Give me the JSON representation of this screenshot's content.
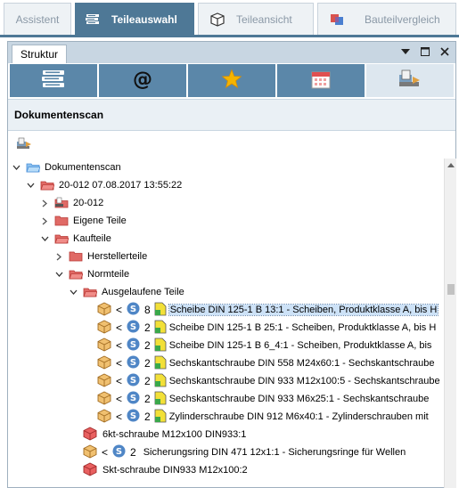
{
  "top_tabs": [
    {
      "label": "Assistent",
      "icon": "none",
      "active": false
    },
    {
      "label": "Teileauswahl",
      "icon": "books-icon",
      "active": true
    },
    {
      "label": "Teileansicht",
      "icon": "cube-icon",
      "active": false
    },
    {
      "label": "Bauteilvergleich",
      "icon": "compare-icon",
      "active": false
    }
  ],
  "panel": {
    "tab_label": "Struktur",
    "controls": [
      "chevron-down-icon",
      "maximize-icon",
      "close-icon"
    ]
  },
  "icon_bar": [
    {
      "icon": "books-icon",
      "active": false
    },
    {
      "icon": "at-icon",
      "active": false
    },
    {
      "icon": "star-icon",
      "active": false
    },
    {
      "icon": "calendar-icon",
      "active": false
    },
    {
      "icon": "document-scan-icon",
      "active": true
    }
  ],
  "section_title": "Dokumentenscan",
  "tree": {
    "root": "Dokumentenscan",
    "scan": "20-012 07.08.2017 13:55:22",
    "doc": "20-012",
    "eigene": "Eigene Teile",
    "kaufteile": "Kaufteile",
    "hersteller": "Herstellerteile",
    "normteile": "Normteile",
    "ausgelaufen": "Ausgelaufene Teile",
    "parts": [
      {
        "lt": "<",
        "count": "8",
        "label": "Scheibe DIN 125-1 B 13:1 - Scheiben, Produktklasse A, bis H",
        "selected": true
      },
      {
        "lt": "<",
        "count": "2",
        "label": "Scheibe DIN 125-1 B 25:1 - Scheiben, Produktklasse A, bis H",
        "selected": false
      },
      {
        "lt": "<",
        "count": "2",
        "label": "Scheibe DIN 125-1 B 6_4:1 - Scheiben, Produktklasse A, bis",
        "selected": false
      },
      {
        "lt": "<",
        "count": "2",
        "label": "Sechskantschraube DIN 558 M24x60:1 - Sechskantschraube",
        "selected": false
      },
      {
        "lt": "<",
        "count": "2",
        "label": "Sechskantschraube DIN 933 M12x100:5 - Sechskantschraube",
        "selected": false
      },
      {
        "lt": "<",
        "count": "2",
        "label": "Sechskantschraube DIN 933 M6x25:1 - Sechskantschraube",
        "selected": false
      },
      {
        "lt": "<",
        "count": "2",
        "label": "Zylinderschraube DIN 912 M6x40:1 - Zylinderschrauben mit",
        "selected": false
      }
    ],
    "loose1": "6kt-schraube M12x100 DIN933:1",
    "loose2": {
      "lt": "<",
      "count": "2",
      "label": "Sicherungsring DIN 471 12x1:1 - Sicherungsringe für Wellen"
    },
    "loose3": "Skt-schraube DIN933 M12x100:2"
  },
  "colors": {
    "accent": "#4e7896",
    "icon_bar_blue": "#5b87a9",
    "folder_red": "#d9534f",
    "folder_blue": "#4a90d9",
    "cube_orange": "#e0a040",
    "cube_red": "#d94b4b",
    "doc_yellow": "#f2e038"
  }
}
